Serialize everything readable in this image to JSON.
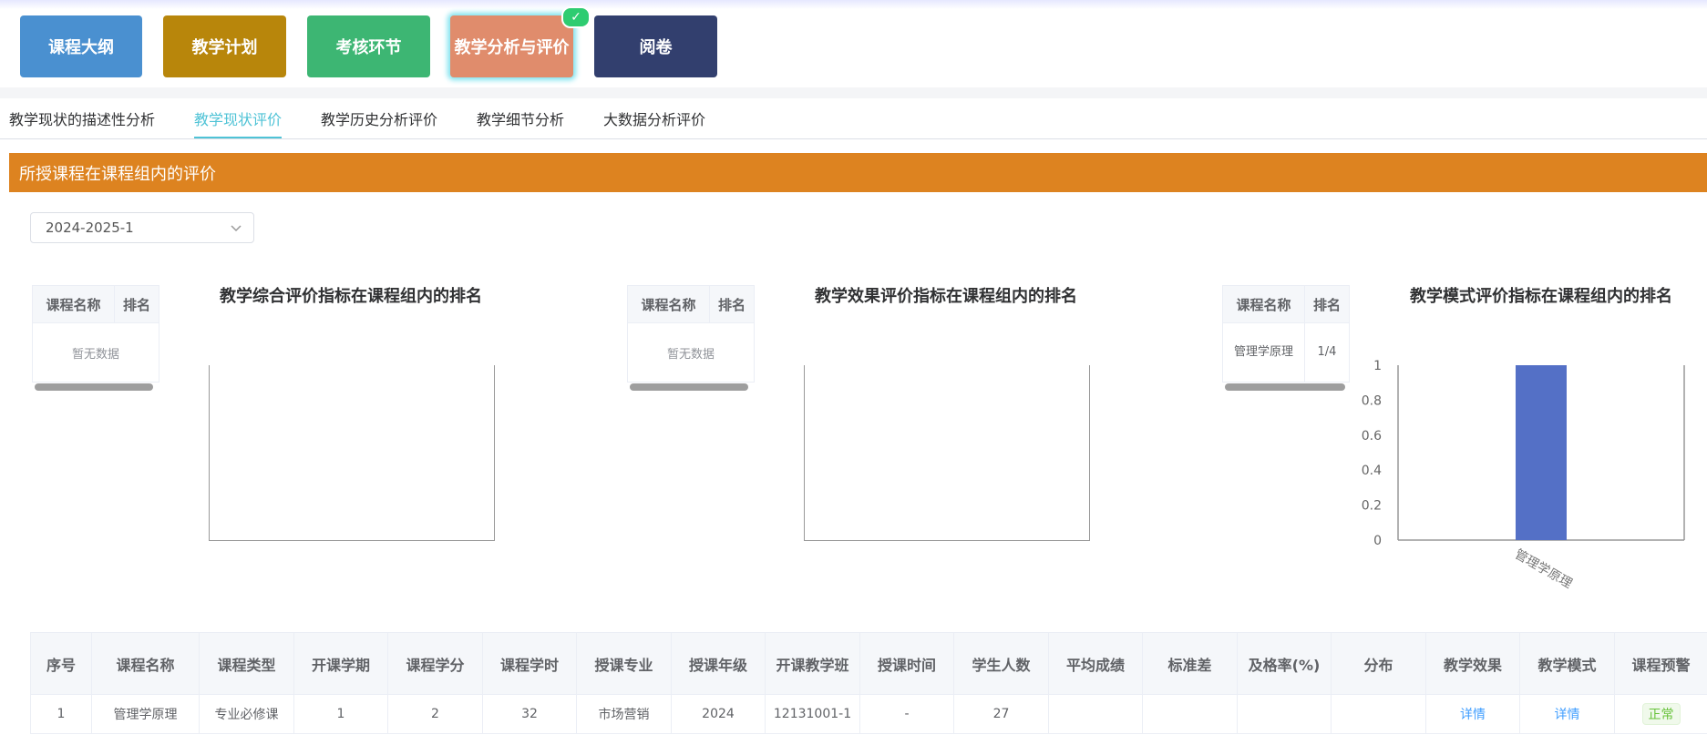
{
  "modules": [
    {
      "label": "课程大纲",
      "color": "#4a90d0"
    },
    {
      "label": "教学计划",
      "color": "#b8860b"
    },
    {
      "label": "考核环节",
      "color": "#3db673"
    },
    {
      "label": "教学分析与评价",
      "color": "#e08c6c"
    },
    {
      "label": "阅卷",
      "color": "#323f6e"
    }
  ],
  "active_module_check": "✓",
  "subtabs": [
    "教学现状的描述性分析",
    "教学现状评价",
    "教学历史分析评价",
    "教学细节分析",
    "大数据分析评价"
  ],
  "active_subtab": 1,
  "section_title": "所授课程在课程组内的评价",
  "term_select": {
    "value": "2024-2025-1"
  },
  "rank_tables": [
    {
      "col_course": "课程名称",
      "col_rank": "排名",
      "empty_text": "暂无数据"
    },
    {
      "col_course": "课程名称",
      "col_rank": "排名",
      "empty_text": "暂无数据"
    },
    {
      "col_course": "课程名称",
      "col_rank": "排名",
      "rows": [
        {
          "course": "管理学原理",
          "rank": "1/4"
        }
      ]
    }
  ],
  "chart_data": [
    {
      "type": "bar",
      "title": "教学综合评价指标在课程组内的排名",
      "categories": [],
      "values": []
    },
    {
      "type": "bar",
      "title": "教学效果评价指标在课程组内的排名",
      "categories": [],
      "values": []
    },
    {
      "type": "bar",
      "title": "教学模式评价指标在课程组内的排名",
      "categories": [
        "管理学原理"
      ],
      "values": [
        1
      ],
      "ylim": [
        0,
        1
      ],
      "yticks": [
        "0",
        "0.2",
        "0.4",
        "0.6",
        "0.8",
        "1"
      ],
      "bar_color": "#5470c6"
    }
  ],
  "table": {
    "headers": [
      "序号",
      "课程名称",
      "课程类型",
      "开课学期",
      "课程学分",
      "课程学时",
      "授课专业",
      "授课年级",
      "开课教学班",
      "授课时间",
      "学生人数",
      "平均成绩",
      "标准差",
      "及格率(%)",
      "分布",
      "教学效果",
      "教学模式",
      "课程预警"
    ],
    "rows": [
      [
        "1",
        "管理学原理",
        "专业必修课",
        "1",
        "2",
        "32",
        "市场营销",
        "2024",
        "12131001-1",
        "-",
        "27",
        "",
        "",
        "",
        "",
        "详情",
        "详情",
        "正常"
      ]
    ]
  }
}
